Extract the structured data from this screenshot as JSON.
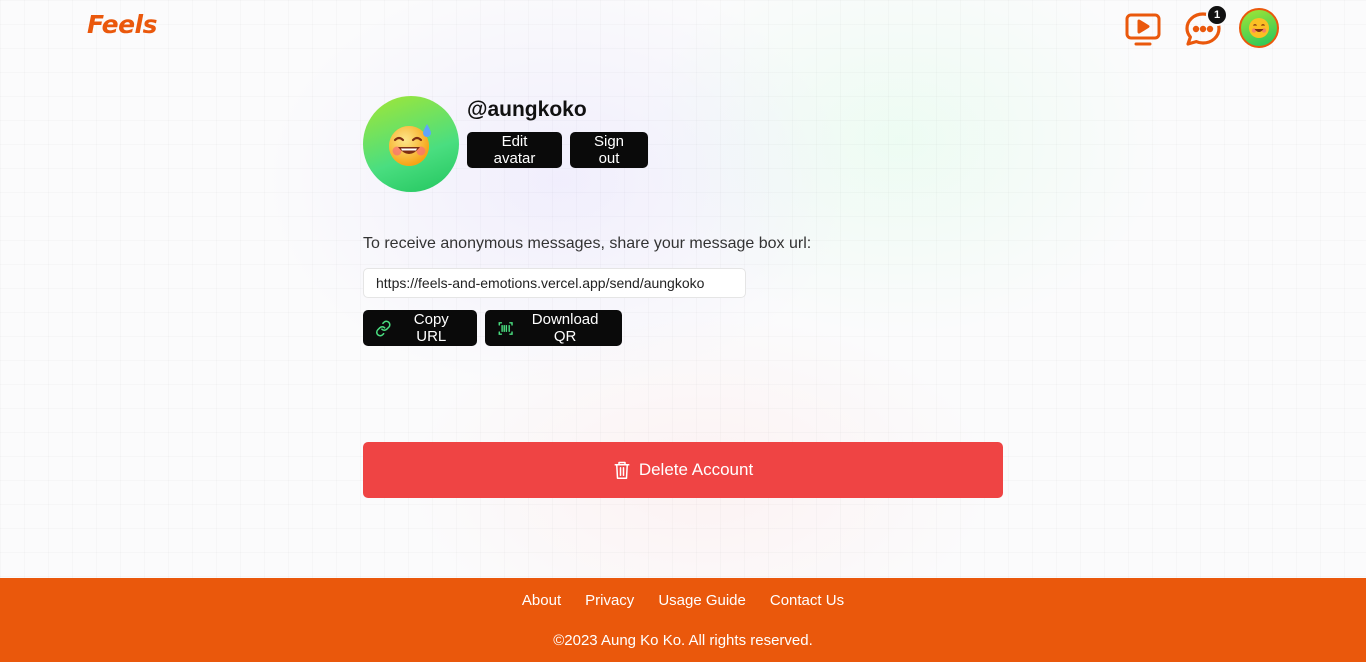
{
  "header": {
    "logo": "Feels",
    "notification_count": "1",
    "icons": [
      "tv-icon",
      "chat-icon",
      "avatar"
    ]
  },
  "profile": {
    "username": "@aungkoko",
    "avatar_emoji": "🥵",
    "edit_avatar_label": "Edit avatar",
    "sign_out_label": "Sign out"
  },
  "share": {
    "instruction": "To receive anonymous messages, share your message box url:",
    "url": "https://feels-and-emotions.vercel.app/send/aungkoko",
    "copy_url_label": "Copy URL",
    "download_qr_label": "Download QR"
  },
  "danger": {
    "delete_account_label": "Delete Account"
  },
  "footer": {
    "links": [
      {
        "label": "About"
      },
      {
        "label": "Privacy"
      },
      {
        "label": "Usage Guide"
      },
      {
        "label": "Contact Us"
      }
    ],
    "copyright": "©2023 Aung Ko Ko. All rights reserved."
  },
  "colors": {
    "brand": "#ea580c",
    "danger": "#ef4444",
    "button_dark": "#0a0a0a",
    "icon_green": "#4ade80"
  }
}
